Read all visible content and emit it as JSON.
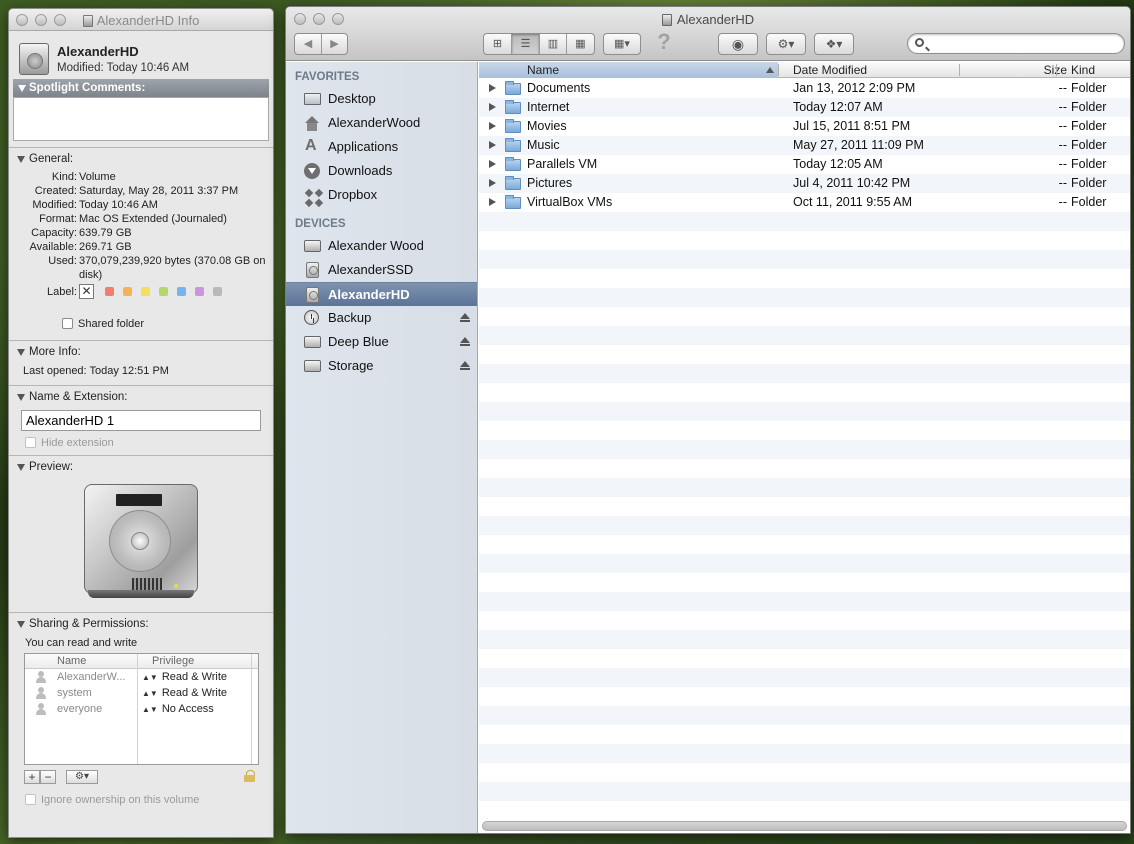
{
  "info_window": {
    "title": "AlexanderHD Info",
    "name": "AlexanderHD",
    "modified_line": "Modified: Today 10:46 AM",
    "spotlight": {
      "label": "Spotlight Comments:",
      "value": ""
    },
    "general": {
      "label": "General:",
      "fields": [
        {
          "key": "Kind:",
          "value": "Volume"
        },
        {
          "key": "Created:",
          "value": "Saturday, May 28, 2011 3:37 PM"
        },
        {
          "key": "Modified:",
          "value": "Today 10:46 AM"
        },
        {
          "key": "Format:",
          "value": "Mac OS Extended (Journaled)"
        },
        {
          "key": "Capacity:",
          "value": "639.79 GB"
        },
        {
          "key": "Available:",
          "value": "269.71 GB"
        },
        {
          "key": "Used:",
          "value": "370,079,239,920 bytes (370.08 GB on disk)"
        }
      ],
      "label_key": "Label:",
      "label_none_glyph": "✕",
      "label_colors": [
        "#f27c6d",
        "#f5b353",
        "#f2df5b",
        "#b4d96a",
        "#77b3ee",
        "#c994e0",
        "#b9b9b9"
      ],
      "shared_folder": "Shared folder"
    },
    "more_info": {
      "label": "More Info:",
      "last_opened": "Last opened: Today 12:51 PM"
    },
    "name_ext": {
      "label": "Name & Extension:",
      "value": "AlexanderHD 1",
      "hide_extension": "Hide extension"
    },
    "preview": {
      "label": "Preview:"
    },
    "sharing": {
      "label": "Sharing & Permissions:",
      "summary": "You can read and write",
      "col_name": "Name",
      "col_privilege": "Privilege",
      "rows": [
        {
          "user": "AlexanderW...",
          "privilege": "Read & Write"
        },
        {
          "user": "system",
          "privilege": "Read & Write"
        },
        {
          "user": "everyone",
          "privilege": "No Access"
        }
      ],
      "add_glyph": "+",
      "remove_glyph": "−",
      "action_glyph": "⚙▾",
      "ignore_ownership": "Ignore ownership on this volume"
    }
  },
  "finder": {
    "title": "AlexanderHD",
    "nav": {
      "back": "◀",
      "forward": "▶"
    },
    "view_glyphs": [
      "⊞",
      "☰",
      "▥",
      "▦"
    ],
    "arrange_glyph": "▦▾",
    "help_glyph": "?",
    "quicklook_glyph": "◉",
    "action_glyph": "⚙▾",
    "dropbox_glyph": "❖▾",
    "search": {
      "placeholder": "",
      "value": ""
    },
    "sidebar": {
      "favorites_label": "FAVORITES",
      "favorites": [
        {
          "label": "Desktop",
          "icon": "desktop-icon"
        },
        {
          "label": "AlexanderWood",
          "icon": "home-icon"
        },
        {
          "label": "Applications",
          "icon": "applications-icon"
        },
        {
          "label": "Downloads",
          "icon": "downloads-icon"
        },
        {
          "label": "Dropbox",
          "icon": "dropbox-icon"
        }
      ],
      "devices_label": "DEVICES",
      "devices": [
        {
          "label": "Alexander Wood",
          "icon": "computer-icon",
          "eject": false
        },
        {
          "label": "AlexanderSSD",
          "icon": "hard-drive-icon",
          "eject": false
        },
        {
          "label": "AlexanderHD",
          "icon": "hard-drive-icon",
          "eject": false,
          "selected": true
        },
        {
          "label": "Backup",
          "icon": "time-machine-icon",
          "eject": true
        },
        {
          "label": "Deep Blue",
          "icon": "external-drive-icon",
          "eject": true
        },
        {
          "label": "Storage",
          "icon": "external-drive-icon",
          "eject": true
        }
      ]
    },
    "columns": {
      "name": "Name",
      "date": "Date Modified",
      "size": "Size",
      "kind": "Kind"
    },
    "files": [
      {
        "name": "Documents",
        "date": "Jan 13, 2012 2:09 PM",
        "size": "--",
        "kind": "Folder"
      },
      {
        "name": "Internet",
        "date": "Today 12:07 AM",
        "size": "--",
        "kind": "Folder"
      },
      {
        "name": "Movies",
        "date": "Jul 15, 2011 8:51 PM",
        "size": "--",
        "kind": "Folder"
      },
      {
        "name": "Music",
        "date": "May 27, 2011 11:09 PM",
        "size": "--",
        "kind": "Folder"
      },
      {
        "name": "Parallels VM",
        "date": "Today 12:05 AM",
        "size": "--",
        "kind": "Folder"
      },
      {
        "name": "Pictures",
        "date": "Jul 4, 2011 10:42 PM",
        "size": "--",
        "kind": "Folder"
      },
      {
        "name": "VirtualBox VMs",
        "date": "Oct 11, 2011 9:55 AM",
        "size": "--",
        "kind": "Folder"
      }
    ]
  }
}
